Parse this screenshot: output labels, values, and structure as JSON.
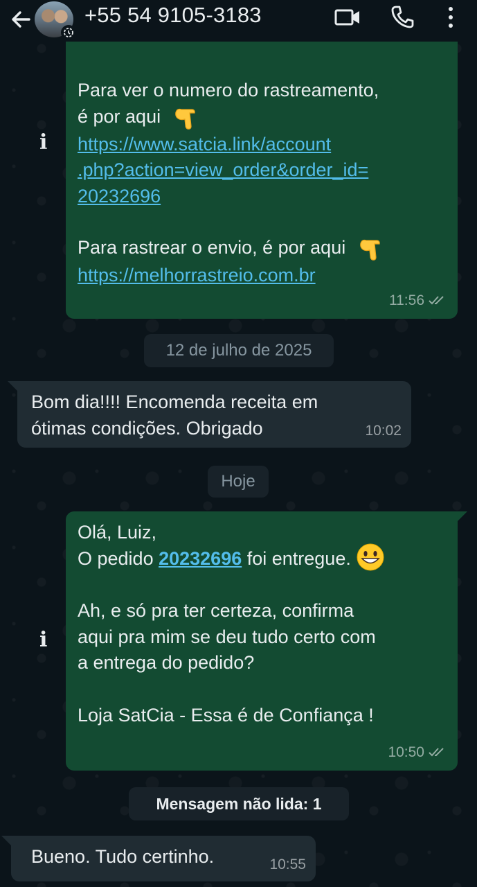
{
  "header": {
    "contact": "+55 54 9105-3183"
  },
  "messages": {
    "m1": {
      "line1": "Para ver o numero do rastreamento,",
      "line2": "é por aqui",
      "link1_a": "https://www.satcia.link/account",
      "link1_b": ".php?action=view_order&order_id=",
      "link1_c": "20232696",
      "line3": "Para rastrear o envio, é por aqui",
      "link2": "https://melhorrastreio.com.br",
      "time": "11:56"
    },
    "date1": "12 de julho de 2025",
    "m2": {
      "line1": "Bom dia!!!! Encomenda receita em",
      "line2": "ótimas condições. Obrigado",
      "time": "10:02"
    },
    "date2": "Hoje",
    "m3": {
      "greeting": "Olá, Luiz,",
      "order_prefix": "O pedido ",
      "order_number": "20232696",
      "order_suffix": " foi entregue.",
      "para1": "Ah, e só pra ter certeza, confirma",
      "para2": "aqui pra mim se deu tudo certo com",
      "para3": "a entrega do pedido?",
      "signature": "Loja SatCia - Essa é de Confiança !",
      "time": "10:50"
    },
    "unread": "Mensagem não lida: 1",
    "m4": {
      "text": "Bueno. Tudo certinho.",
      "time": "10:55"
    }
  },
  "info_glyph": "i",
  "colors": {
    "background": "#0b141a",
    "outgoing": "#134b32",
    "incoming": "#202c33",
    "link": "#53bdeb"
  },
  "icons": [
    "back-arrow-icon",
    "video-call-icon",
    "phone-icon",
    "more-icon",
    "read-ticks-icon",
    "point-down-emoji",
    "grinning-emoji"
  ]
}
